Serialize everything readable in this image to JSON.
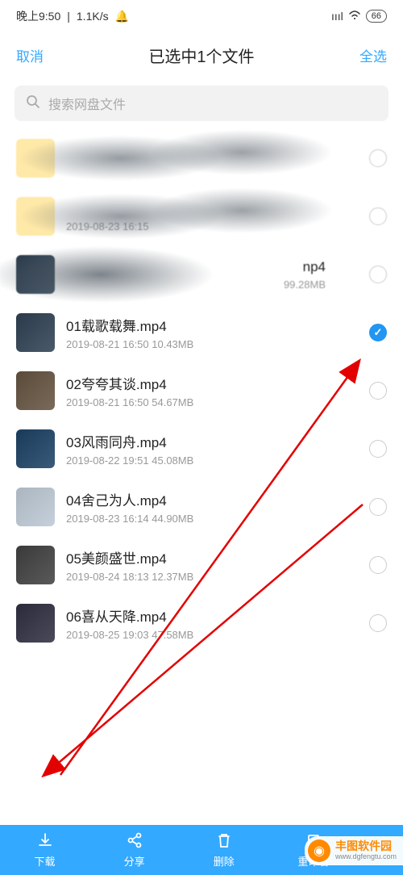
{
  "status": {
    "time": "晚上9:50",
    "speed": "1.1K/s",
    "bell": "🔕",
    "signal": "ıııl",
    "wifi": "⋮",
    "battery": "66"
  },
  "header": {
    "cancel": "取消",
    "title": "已选中1个文件",
    "select_all": "全选"
  },
  "search": {
    "placeholder": "搜索网盘文件"
  },
  "files": [
    {
      "name": "",
      "meta": "",
      "thumb": "folder",
      "selected": false,
      "blurred": true
    },
    {
      "name": "",
      "meta": "2019-08-23  16:15",
      "thumb": "folder",
      "selected": false,
      "blurred": true
    },
    {
      "name": "",
      "meta": "99.28MB",
      "name_suffix": "np4",
      "thumb": "v1",
      "selected": false,
      "blurred": true
    },
    {
      "name": "01载歌载舞.mp4",
      "meta": "2019-08-21  16:50   10.43MB",
      "thumb": "v1",
      "selected": true
    },
    {
      "name": "02夸夸其谈.mp4",
      "meta": "2019-08-21  16:50   54.67MB",
      "thumb": "v2",
      "selected": false
    },
    {
      "name": "03风雨同舟.mp4",
      "meta": "2019-08-22  19:51   45.08MB",
      "thumb": "v3",
      "selected": false
    },
    {
      "name": "04舍己为人.mp4",
      "meta": "2019-08-23  16:14   44.90MB",
      "thumb": "v4",
      "selected": false
    },
    {
      "name": "05美颜盛世.mp4",
      "meta": "2019-08-24  18:13   12.37MB",
      "thumb": "v5",
      "selected": false
    },
    {
      "name": "06喜从天降.mp4",
      "meta": "2019-08-25  19:03   47.58MB",
      "thumb": "v6",
      "selected": false
    }
  ],
  "bottom": {
    "download": "下载",
    "share": "分享",
    "delete": "删除",
    "rename": "重命名"
  },
  "watermark": {
    "main": "丰图软件园",
    "sub": "www.dgfengtu.com"
  }
}
